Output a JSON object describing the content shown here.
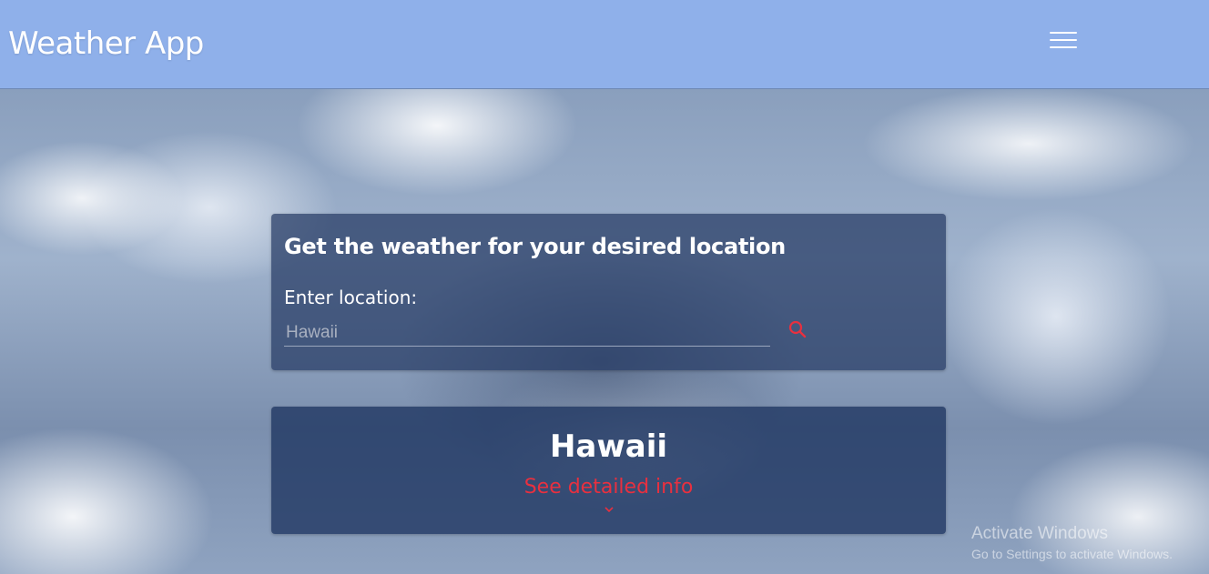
{
  "header": {
    "brand": "Weather App",
    "menu_icon": "hamburger-menu-icon",
    "background_color": "#8fb0ea"
  },
  "search": {
    "title": "Get the weather for your desired location",
    "label": "Enter location:",
    "placeholder": "Hawaii",
    "value": "",
    "search_icon": "search-icon",
    "accent_color": "#e8303f"
  },
  "result": {
    "city": "Hawaii",
    "detail_link": "See detailed info",
    "expand_icon": "chevron-down-icon"
  },
  "watermark": {
    "title": "Activate Windows",
    "subtitle": "Go to Settings to activate Windows."
  }
}
